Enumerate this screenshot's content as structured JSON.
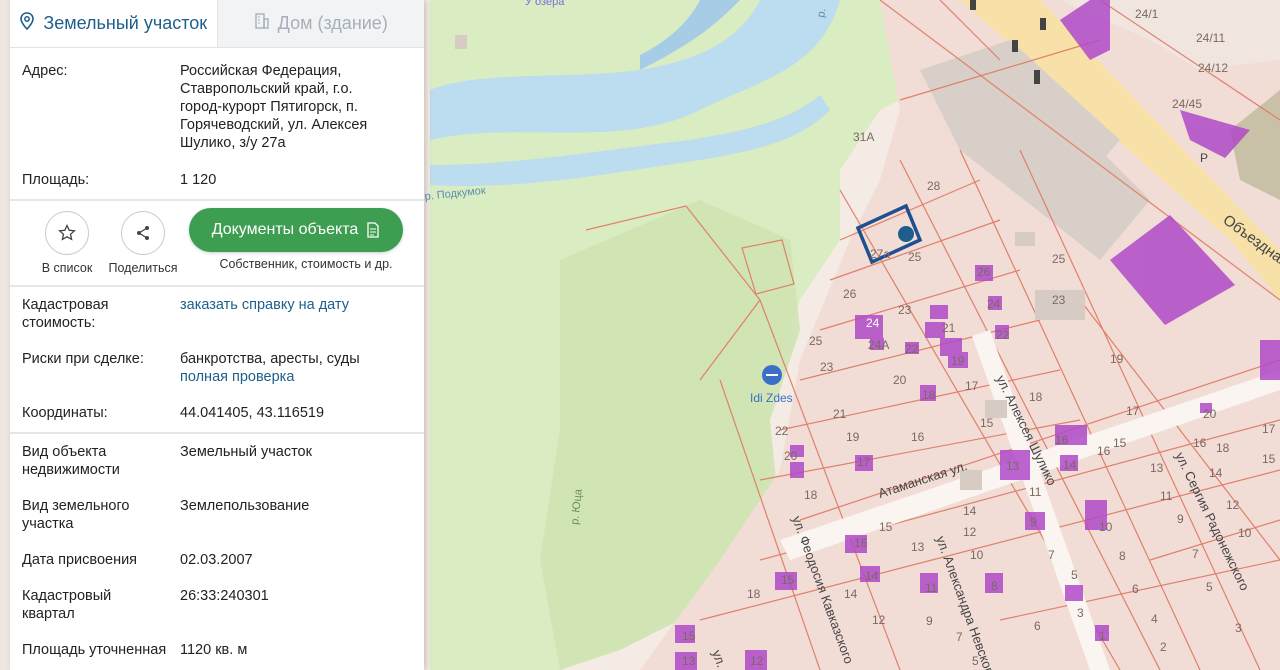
{
  "tabs": [
    {
      "label": "Земельный участок",
      "icon": "map-pin-icon",
      "active": true
    },
    {
      "label": "Дом (здание)",
      "icon": "building-icon",
      "active": false
    }
  ],
  "details": {
    "address": {
      "label": "Адрес:",
      "lines": [
        "Российская Федерация,",
        "Ставропольский край, г.о.",
        "город-курорт Пятигорск, п.",
        "Горячеводский, ул. Алексея",
        "Шулико, з/у 27а"
      ]
    },
    "area": {
      "label": "Площадь:",
      "value": "1 120"
    },
    "cadastral_value": {
      "label_lines": [
        "Кадастровая",
        "стоимость:"
      ],
      "link": "заказать справку на дату"
    },
    "risks": {
      "label": "Риски при сделке:",
      "value": "банкротства, аресты, суды",
      "link": "полная проверка"
    },
    "coords": {
      "label": "Координаты:",
      "value": "44.041405, 43.116519"
    },
    "object_type": {
      "label_lines": [
        "Вид объекта",
        "недвижимости"
      ],
      "value": "Земельный участок"
    },
    "land_type": {
      "label_lines": [
        "Вид земельного",
        "участка"
      ],
      "value": "Землепользование"
    },
    "assign_date": {
      "label": "Дата присвоения",
      "value": "02.03.2007"
    },
    "quarter": {
      "label_lines": [
        "Кадастровый",
        "квартал"
      ],
      "value": "26:33:240301"
    },
    "refined_area": {
      "label": "Площадь уточненная",
      "value": "1120 кв. м"
    }
  },
  "actions": {
    "favorite": {
      "label": "В список",
      "icon": "star-icon"
    },
    "share": {
      "label": "Поделиться",
      "icon": "share-icon"
    },
    "documents": {
      "label": "Документы объекта",
      "icon": "document-icon",
      "sub": "Собственник, стоимость и др."
    }
  },
  "map": {
    "river_label": "р. Подкумок",
    "river_label_2": "р. Юца",
    "top_label": "У озера",
    "poi_label": "Idi Zdes",
    "streets": [
      "Атаманская ул.",
      "ул. Алексея Шулико",
      "ул. Сергия Радонежского",
      "ул. Александра Невского",
      "ул. Феодосия Кавказского",
      "Объездная",
      "ул."
    ],
    "parcel_numbers": [
      "24/1",
      "24/11",
      "24/12",
      "24/45",
      "31А",
      "28",
      "27а",
      "25",
      "26",
      "24",
      "24А",
      "23",
      "22",
      "21",
      "20",
      "19",
      "18",
      "17",
      "16",
      "15",
      "14",
      "13",
      "12",
      "11",
      "10",
      "9",
      "8",
      "7",
      "6",
      "5",
      "4",
      "3",
      "2",
      "1"
    ],
    "parking_label": "Р",
    "colors": {
      "accent": "#1d5f8c",
      "button": "#3d9e52",
      "water": "#bcdcef",
      "green": "#d8ecc0",
      "parcel_line": "#e0806a",
      "building": "#b04ac8"
    }
  }
}
